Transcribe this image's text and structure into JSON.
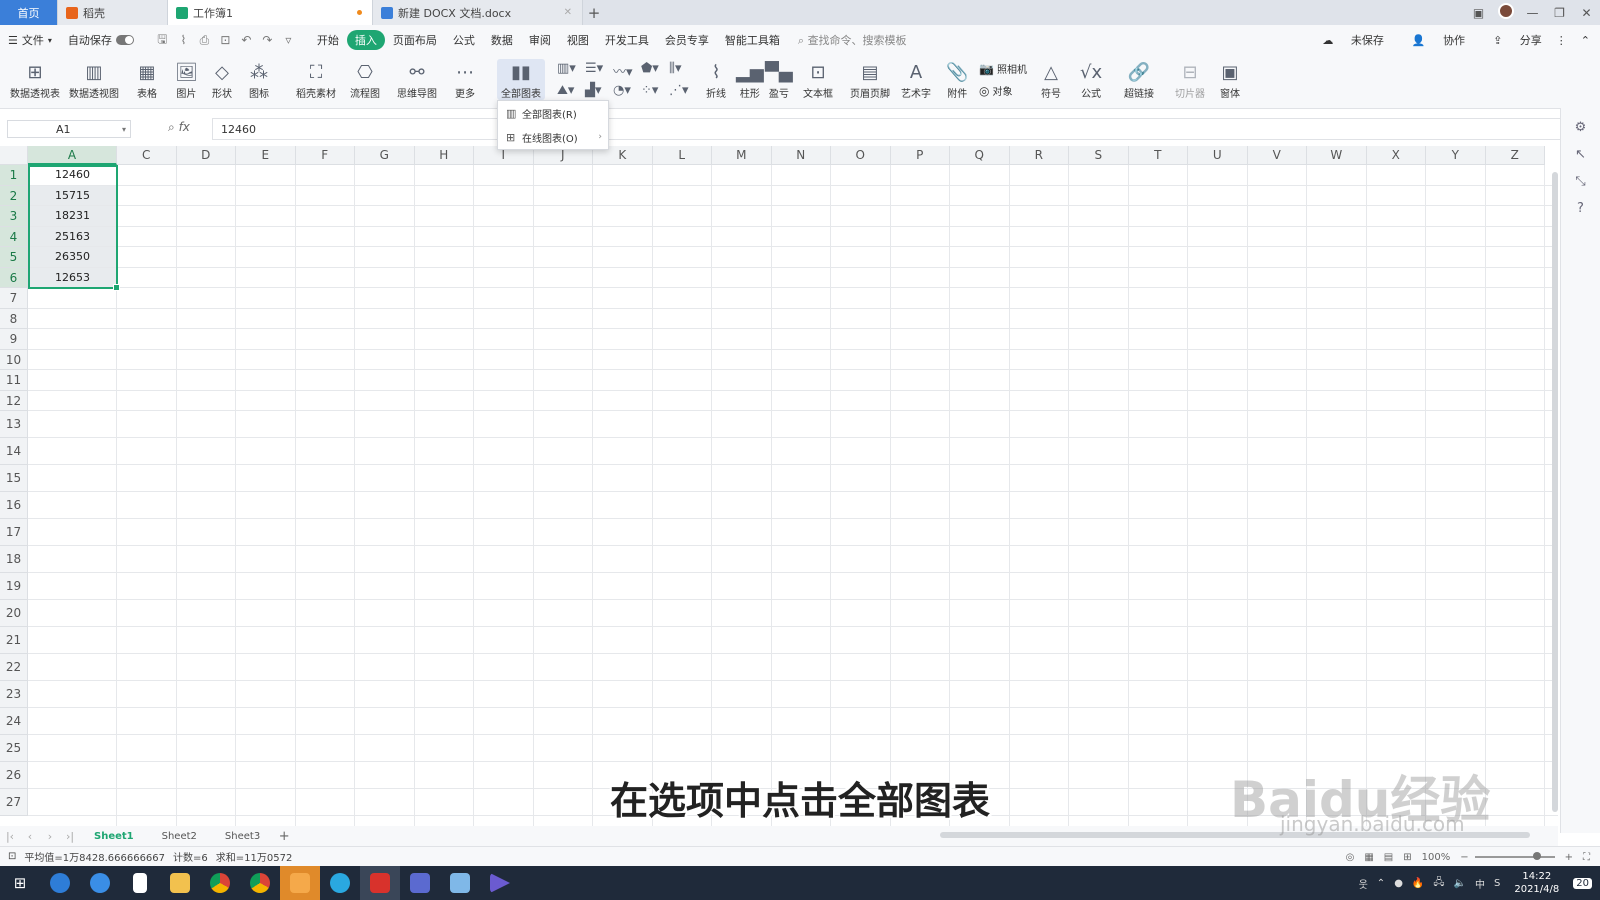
{
  "tabs": {
    "home": "首页",
    "rice": "稻壳",
    "workbook": "工作簿1",
    "doc": "新建 DOCX 文档.docx"
  },
  "menubar": {
    "file": "文件",
    "autosave": "自动保存",
    "items": [
      "开始",
      "插入",
      "页面布局",
      "公式",
      "数据",
      "审阅",
      "视图",
      "开发工具",
      "会员专享",
      "智能工具箱"
    ],
    "active_index": 1,
    "search_placeholder": "查找命令、搜索模板",
    "unsaved": "未保存",
    "collab": "协作",
    "share": "分享"
  },
  "ribbon": {
    "pivot_table": "数据透视表",
    "pivot_view": "数据透视图",
    "table": "表格",
    "picture": "图片",
    "shape": "形状",
    "icon": "图标",
    "rice_material": "稻壳素材",
    "flowchart": "流程图",
    "mindmap": "思维导图",
    "more": "更多",
    "all_charts": "全部图表",
    "line": "折线",
    "column": "柱形",
    "win_loss": "盈亏",
    "textbox": "文本框",
    "header_footer": "页眉页脚",
    "wordart": "艺术字",
    "attachment": "附件",
    "camera": "照相机",
    "object": "对象",
    "symbol": "符号",
    "formula": "公式",
    "hyperlink": "超链接",
    "slicer": "切片器",
    "window": "窗体"
  },
  "dropdown": {
    "all_charts": "全部图表(R)",
    "online_charts": "在线图表(O)"
  },
  "formula_bar": {
    "name_box": "A1",
    "fx": "fx",
    "value": "12460"
  },
  "grid": {
    "columns": [
      "A",
      "C",
      "D",
      "E",
      "F",
      "G",
      "H",
      "I",
      "J",
      "K",
      "L",
      "M",
      "N",
      "O",
      "P",
      "Q",
      "R",
      "S",
      "T",
      "U",
      "V",
      "W",
      "X",
      "Y",
      "Z"
    ],
    "rows": [
      "1",
      "2",
      "3",
      "4",
      "5",
      "6",
      "7",
      "8",
      "9",
      "10",
      "11",
      "12",
      "13",
      "14",
      "15",
      "16",
      "17",
      "18",
      "19",
      "20",
      "21",
      "22",
      "23",
      "24",
      "25",
      "26",
      "27"
    ],
    "values": [
      "12460",
      "15715",
      "18231",
      "25163",
      "26350",
      "12653"
    ]
  },
  "sheets": [
    "Sheet1",
    "Sheet2",
    "Sheet3"
  ],
  "status": {
    "average": "平均值=1万8428.666666667",
    "count": "计数=6",
    "sum": "求和=11万0572",
    "zoom": "100%"
  },
  "subtitle": "在选项中点击全部图表",
  "watermark": "Baidu经验",
  "watermark_url": "jingyan.baidu.com",
  "taskbar": {
    "time": "14:22",
    "date": "2021/4/8",
    "ime": "中",
    "notifications": "20"
  }
}
